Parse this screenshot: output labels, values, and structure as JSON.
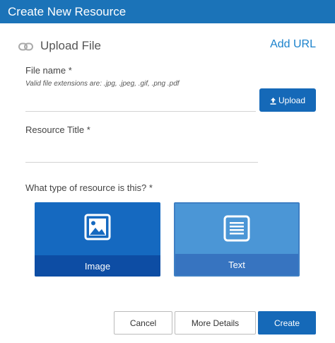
{
  "dialog": {
    "title": "Create New Resource"
  },
  "upload_section": {
    "heading": "Upload File",
    "add_url_label": "Add URL"
  },
  "file_name_field": {
    "label": "File name *",
    "hint": "Valid file extensions are: .jpg, .jpeg, .gif, .png .pdf",
    "value": "",
    "upload_button_label": "Upload"
  },
  "resource_title_field": {
    "label": "Resource Title *",
    "value": ""
  },
  "resource_type": {
    "question": "What type of resource is this? *",
    "options": [
      {
        "label": "Image",
        "icon": "image-icon",
        "selected": true
      },
      {
        "label": "Text",
        "icon": "document-text-icon",
        "selected": false
      }
    ]
  },
  "footer": {
    "cancel_label": "Cancel",
    "more_details_label": "More Details",
    "create_label": "Create"
  },
  "colors": {
    "header": "#1b73b8",
    "primary_button": "#1569b8",
    "link": "#1b82cc",
    "selected_card": "#1569c0",
    "unselected_card": "#4b96d6"
  }
}
